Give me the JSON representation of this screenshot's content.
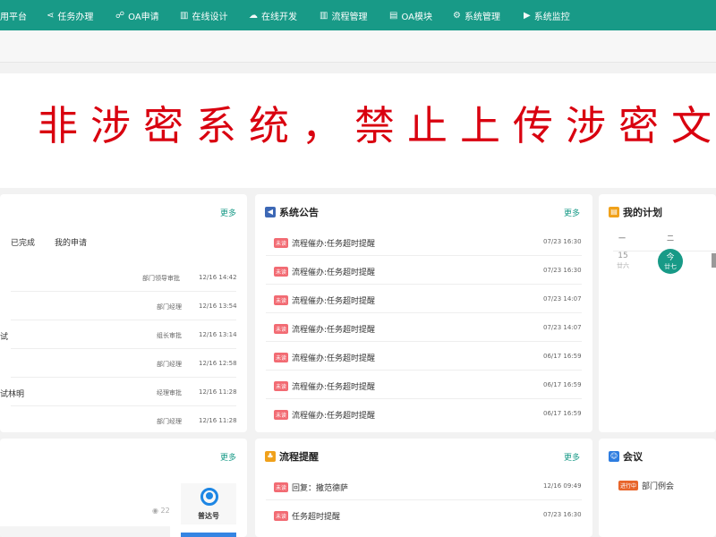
{
  "nav": {
    "items": [
      {
        "label": "用平台",
        "icon": "platform-icon",
        "glyph": ""
      },
      {
        "label": "任务办理",
        "icon": "share-icon",
        "glyph": "⋖"
      },
      {
        "label": "OA申请",
        "icon": "user-group-icon",
        "glyph": "☍"
      },
      {
        "label": "在线设计",
        "icon": "chart-bar-icon",
        "glyph": "▥"
      },
      {
        "label": "在线开发",
        "icon": "cloud-icon",
        "glyph": "☁"
      },
      {
        "label": "流程管理",
        "icon": "chart-bar-icon",
        "glyph": "▥"
      },
      {
        "label": "OA模块",
        "icon": "document-icon",
        "glyph": "▤"
      },
      {
        "label": "系统管理",
        "icon": "gear-icon",
        "glyph": "⚙"
      },
      {
        "label": "系统监控",
        "icon": "video-icon",
        "glyph": "▶"
      }
    ]
  },
  "banner": {
    "text": "非涉密系统，禁止上传涉密文"
  },
  "tasks": {
    "more": "更多",
    "tabs": [
      "已完成",
      "我的申请"
    ],
    "rows": [
      {
        "title": "",
        "node": "部门领导审批",
        "time": "12/16 14:42"
      },
      {
        "title": "",
        "node": "部门经理",
        "time": "12/16 13:54"
      },
      {
        "title": "试",
        "node": "组长审批",
        "time": "12/16 13:14"
      },
      {
        "title": "",
        "node": "部门经理",
        "time": "12/16 12:58"
      },
      {
        "title": "试林明",
        "node": "经理审批",
        "time": "12/16 11:28"
      },
      {
        "title": "",
        "node": "部门经理",
        "time": "12/16 11:28"
      }
    ]
  },
  "notice": {
    "title": "系统公告",
    "more": "更多",
    "badge": "未读",
    "rows": [
      {
        "title": "流程催办:任务超时提醒",
        "time": "07/23 16:30"
      },
      {
        "title": "流程催办:任务超时提醒",
        "time": "07/23 16:30"
      },
      {
        "title": "流程催办:任务超时提醒",
        "time": "07/23 14:07"
      },
      {
        "title": "流程催办:任务超时提醒",
        "time": "07/23 14:07"
      },
      {
        "title": "流程催办:任务超时提醒",
        "time": "06/17 16:59"
      },
      {
        "title": "流程催办:任务超时提醒",
        "time": "06/17 16:59"
      },
      {
        "title": "流程催办:任务超时提醒",
        "time": "06/17 16:59"
      }
    ]
  },
  "plan": {
    "title": "我的计划",
    "weekdays": [
      "一",
      "二"
    ],
    "days": [
      {
        "num": "15",
        "lunar": "廿六"
      },
      {
        "num": "今",
        "lunar": "廿七"
      }
    ]
  },
  "news": {
    "more": "更多",
    "views": "22",
    "card": "普达号"
  },
  "remind": {
    "title": "流程提醒",
    "more": "更多",
    "badge": "未读",
    "rows": [
      {
        "title": "回复：撒范德萨",
        "time": "12/16 09:49"
      },
      {
        "title": "任务超时提醒",
        "time": "07/23 16:30"
      }
    ]
  },
  "meeting": {
    "title": "会议",
    "status": "进行中",
    "row": "部门例会"
  }
}
